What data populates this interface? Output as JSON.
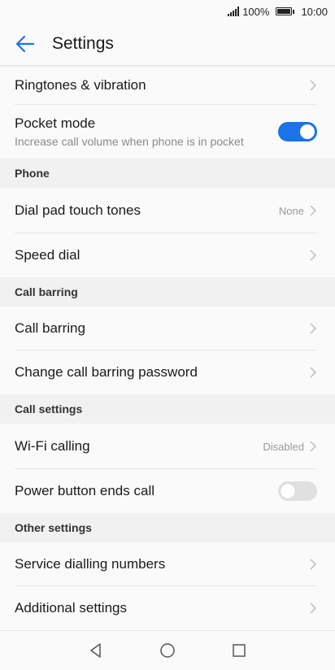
{
  "status_bar": {
    "battery": "100%",
    "time": "10:00"
  },
  "app_bar": {
    "title": "Settings"
  },
  "rows_top": [
    {
      "label": "Ringtones & vibration"
    }
  ],
  "pocket_mode": {
    "label": "Pocket mode",
    "sub": "Increase call volume when phone is in pocket",
    "on": true
  },
  "sections": {
    "phone": "Phone",
    "call_barring": "Call barring",
    "call_settings": "Call settings",
    "other_settings": "Other settings"
  },
  "items": {
    "dial_pad": {
      "label": "Dial pad touch tones",
      "value": "None"
    },
    "speed_dial": {
      "label": "Speed dial"
    },
    "call_barring": {
      "label": "Call barring"
    },
    "change_barring_password": {
      "label": "Change call barring password"
    },
    "wifi_calling": {
      "label": "Wi-Fi calling",
      "value": "Disabled"
    },
    "power_button": {
      "label": "Power button ends call",
      "on": false
    },
    "service_dialling": {
      "label": "Service dialling numbers"
    },
    "additional": {
      "label": "Additional settings"
    }
  },
  "colors": {
    "accent": "#1a73e8",
    "header_bg": "#f1f1f1",
    "page_bg": "#fafafa"
  },
  "icons": {
    "back": "arrow-left-icon",
    "chevron": "chevron-right-icon",
    "nav_back": "triangle-back-icon",
    "nav_home": "circle-home-icon",
    "nav_recent": "square-recent-icon"
  }
}
